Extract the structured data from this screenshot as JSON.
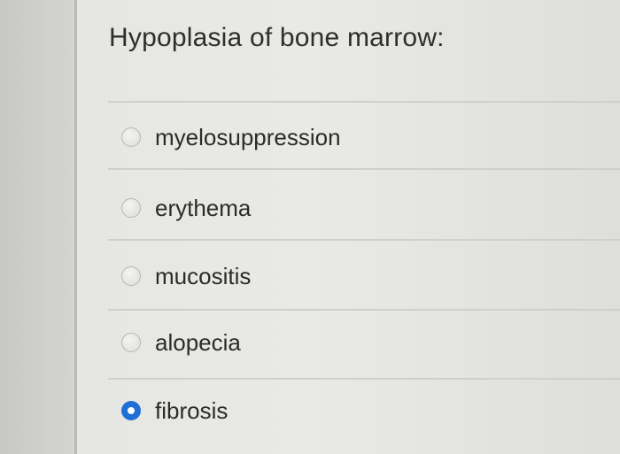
{
  "question": {
    "text": "Hypoplasia of bone marrow:"
  },
  "options": [
    {
      "label": "myelosuppression",
      "selected": false
    },
    {
      "label": "erythema",
      "selected": false
    },
    {
      "label": "mucositis",
      "selected": false
    },
    {
      "label": "alopecia",
      "selected": false
    },
    {
      "label": "fibrosis",
      "selected": true
    }
  ],
  "colors": {
    "selected_radio": "#1f70d6",
    "text": "#2b2b2b"
  }
}
